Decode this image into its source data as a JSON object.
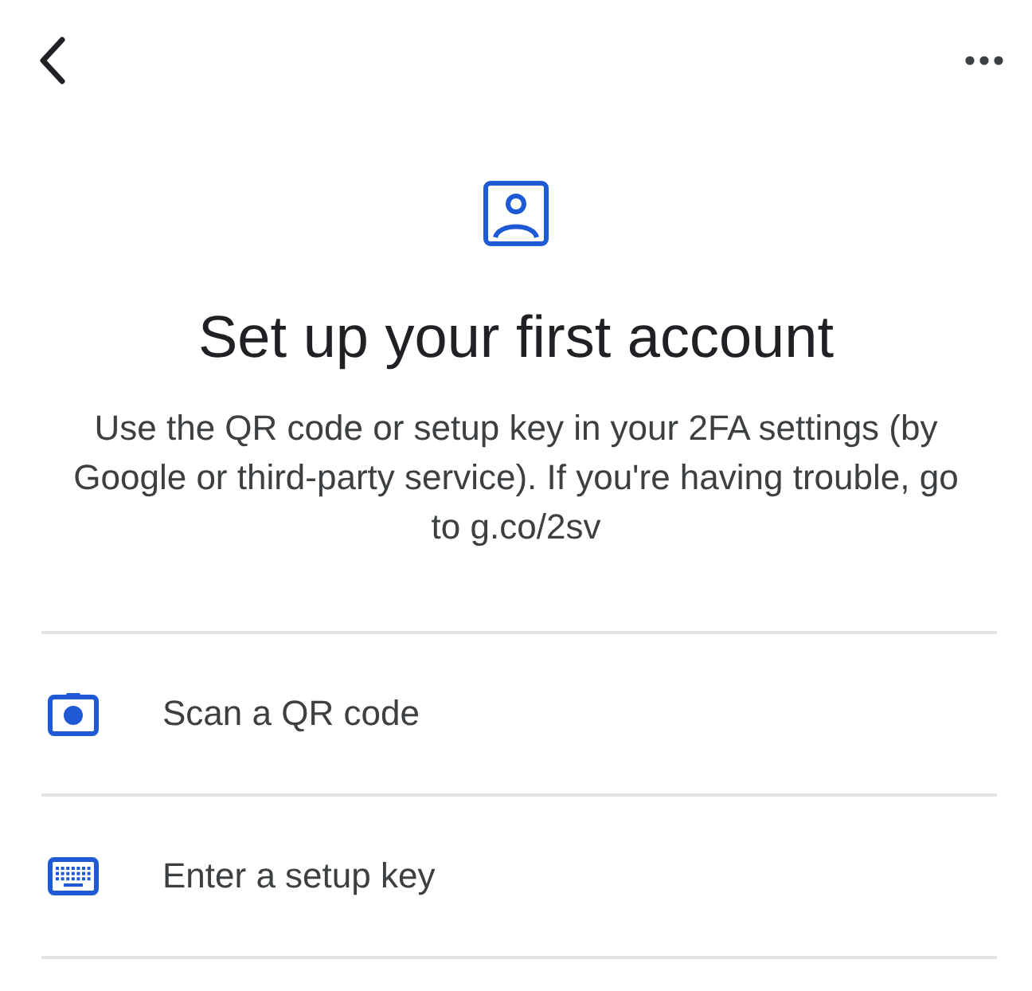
{
  "header": {
    "title": "Set up your first account",
    "description": "Use the QR code or setup key in your 2FA settings (by Google or third-party service). If you're having trouble, go to g.co/2sv"
  },
  "options": [
    {
      "kind": "scan",
      "label": "Scan a QR code"
    },
    {
      "kind": "key",
      "label": "Enter a setup key"
    }
  ]
}
